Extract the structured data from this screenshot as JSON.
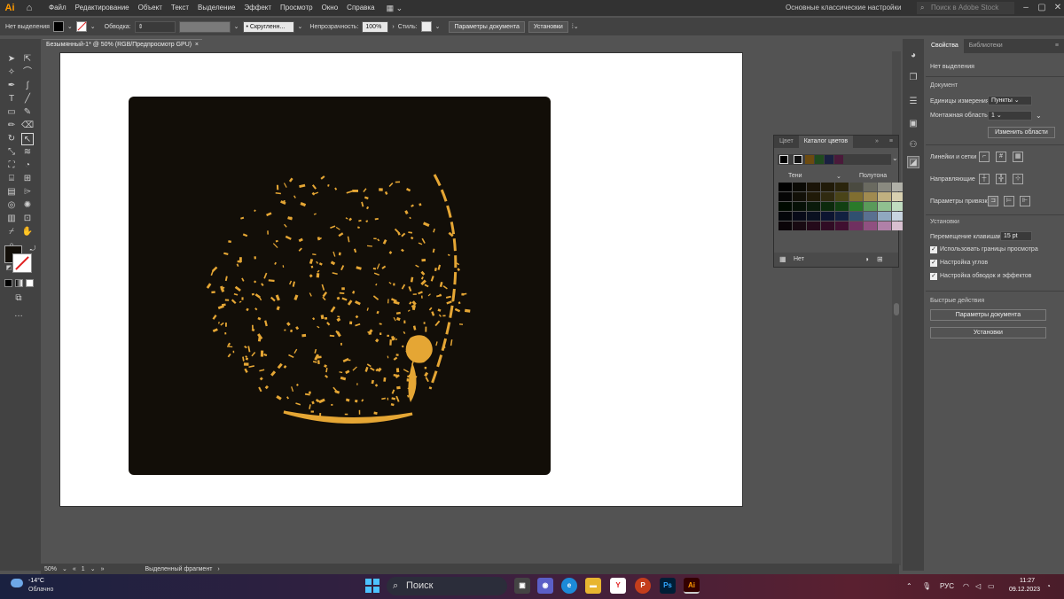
{
  "app": {
    "logo": "Ai",
    "home_icon": "home-icon"
  },
  "menu": [
    "Файл",
    "Редактирование",
    "Объект",
    "Текст",
    "Выделение",
    "Эффект",
    "Просмотр",
    "Окно",
    "Справка"
  ],
  "workspace": "Основные классические настройки",
  "search": {
    "placeholder": "Поиск в Adobe Stock"
  },
  "control_bar": {
    "selection": "Нет выделения",
    "stroke_label": "Обводка:",
    "brush": "Скругленн...",
    "opacity_label": "Непрозрачность:",
    "opacity_value": "100%",
    "style_label": "Стиль:",
    "doc_settings_btn": "Параметры документа",
    "prefs_btn": "Установки"
  },
  "document_tab": {
    "title": "Безымянный-1* @ 50% (RGB/Предпросмотр GPU)",
    "close": "×"
  },
  "artwork": {
    "background_color": "#120e08",
    "fill_color": "#e5a634"
  },
  "status_bar": {
    "zoom": "50%",
    "page": "1",
    "tool_status": "Выделенный фрагмент"
  },
  "swatches_panel": {
    "tabs": [
      "Цвет",
      "Каталог цветов"
    ],
    "group_shadows": "Тени",
    "group_halftone": "Полутона",
    "footer_label": "Нет",
    "grid_colors": [
      "#000000",
      "#0b0a05",
      "#1a1408",
      "#201a08",
      "#2a240c",
      "#4a4a40",
      "#6a6a60",
      "#8a8a80",
      "#b0b0a8",
      "#060606",
      "#121008",
      "#201a08",
      "#302a10",
      "#4a4418",
      "#806e30",
      "#a08a50",
      "#c0b080",
      "#d8d0b0",
      "#000a00",
      "#061006",
      "#0a1a0a",
      "#0c2a0c",
      "#124012",
      "#2a7a2a",
      "#5a9a5a",
      "#90c090",
      "#c0dcc0",
      "#04060a",
      "#080a18",
      "#0a1020",
      "#0c1430",
      "#122040",
      "#305070",
      "#5a7090",
      "#90a8c0",
      "#c8d4e0",
      "#0a0408",
      "#180a12",
      "#240a1a",
      "#300c24",
      "#401030",
      "#703060",
      "#905080",
      "#b080a8",
      "#d8c0d0"
    ],
    "header_swatches": [
      "#000000",
      "#1a1a1a",
      "#6b4a10",
      "#1f4a1f",
      "#1a2040",
      "#4a1a3a"
    ]
  },
  "properties": {
    "tabs": [
      "Свойства",
      "Библиотеки"
    ],
    "no_selection": "Нет выделения",
    "document_section": "Документ",
    "units_label": "Единицы измерения:",
    "units_value": "Пункты",
    "artboard_label": "Монтажная область:",
    "artboard_value": "1",
    "edit_artboards_btn": "Изменить области",
    "rulers_label": "Линейки и сетки",
    "guides_label": "Направляющие",
    "snap_label": "Параметры привязки",
    "preferences_section": "Установки",
    "keyboard_increment_label": "Перемещение клавишами:",
    "keyboard_increment_value": "15 pt",
    "check_preview_bounds": "Использовать границы просмотра",
    "check_scale_corners": "Настройка углов",
    "check_scale_strokes": "Настройка обводок и эффектов",
    "quick_actions": "Быстрые действия",
    "qa_doc_settings": "Параметры документа",
    "qa_prefs": "Установки"
  },
  "taskbar": {
    "temp": "-14°C",
    "weather": "Облачно",
    "search": "Поиск",
    "lang": "РУС",
    "time": "11:27",
    "date": "09.12.2023",
    "apps": [
      "Ps",
      "Ai"
    ]
  }
}
